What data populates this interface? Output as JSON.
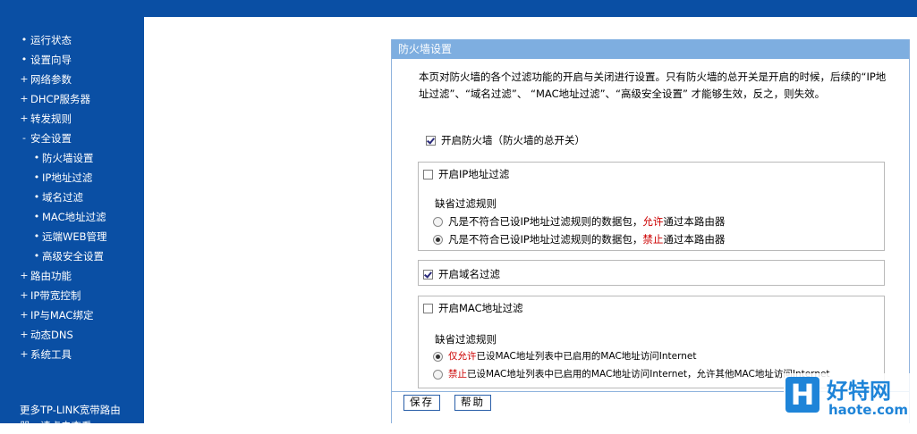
{
  "sidebar": {
    "items": [
      {
        "bullet": "•",
        "label": "运行状态",
        "sub": false
      },
      {
        "bullet": "•",
        "label": "设置向导",
        "sub": false
      },
      {
        "bullet": "+",
        "label": "网络参数",
        "sub": false
      },
      {
        "bullet": "+",
        "label": "DHCP服务器",
        "sub": false
      },
      {
        "bullet": "+",
        "label": "转发规则",
        "sub": false
      },
      {
        "bullet": "-",
        "label": "安全设置",
        "sub": false
      },
      {
        "bullet": "•",
        "label": "防火墙设置",
        "sub": true
      },
      {
        "bullet": "•",
        "label": "IP地址过滤",
        "sub": true
      },
      {
        "bullet": "•",
        "label": "域名过滤",
        "sub": true
      },
      {
        "bullet": "•",
        "label": "MAC地址过滤",
        "sub": true
      },
      {
        "bullet": "•",
        "label": "远端WEB管理",
        "sub": true
      },
      {
        "bullet": "•",
        "label": "高级安全设置",
        "sub": true
      },
      {
        "bullet": "+",
        "label": "路由功能",
        "sub": false
      },
      {
        "bullet": "+",
        "label": "IP带宽控制",
        "sub": false
      },
      {
        "bullet": "+",
        "label": "IP与MAC绑定",
        "sub": false
      },
      {
        "bullet": "+",
        "label": "动态DNS",
        "sub": false
      },
      {
        "bullet": "+",
        "label": "系统工具",
        "sub": false
      }
    ],
    "more_line1": "更多TP-LINK宽带路由",
    "more_line2": "器，请点击查看 >>"
  },
  "panel": {
    "title": "防火墙设置",
    "description": "本页对防火墙的各个过滤功能的开启与关闭进行设置。只有防火墙的总开关是开启的时候，后续的“IP地址过滤”、“域名过滤”、 “MAC地址过滤”、“高级安全设置” 才能够生效，反之，则失效。",
    "firewall_master": {
      "label": "开启防火墙（防火墙的总开关）",
      "checked": true
    },
    "ip_filter": {
      "label": "开启IP地址过滤",
      "checked": false,
      "rule_heading": "缺省过滤规则",
      "option1": {
        "pre": "凡是不符合已设IP地址过滤规则的数据包，",
        "em": "允许",
        "post": "通过本路由器",
        "selected": false
      },
      "option2": {
        "pre": "凡是不符合已设IP地址过滤规则的数据包，",
        "em": "禁止",
        "post": "通过本路由器",
        "selected": true
      }
    },
    "domain_filter": {
      "label": "开启域名过滤",
      "checked": true
    },
    "mac_filter": {
      "label": "开启MAC地址过滤",
      "checked": false,
      "rule_heading": "缺省过滤规则",
      "option1": {
        "em": "仅允许",
        "post": "已设MAC地址列表中已启用的MAC地址访问Internet",
        "selected": true
      },
      "option2": {
        "em": "禁止",
        "post": "已设MAC地址列表中已启用的MAC地址访问Internet，允许其他MAC地址访问Internet",
        "selected": false
      }
    },
    "save_label": "保存",
    "help_label": "帮助"
  },
  "watermark": {
    "cn": "好特网",
    "en": "haote.com",
    "logo": "H"
  },
  "colors": {
    "brand_blue": "#0a4fa4",
    "panel_header": "#7eaee0",
    "emphasis_red": "#cc0000"
  }
}
